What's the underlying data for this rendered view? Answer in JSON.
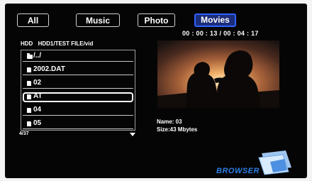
{
  "tabs": [
    {
      "label": "All",
      "active": false
    },
    {
      "label": "Music",
      "active": false
    },
    {
      "label": "Photo",
      "active": false
    },
    {
      "label": "Movies",
      "active": true
    }
  ],
  "playback": {
    "elapsed": "00 : 00 : 13",
    "separator": "/",
    "total": "00 : 04 : 17"
  },
  "path": {
    "device": "HDD",
    "location": "HDD1/TEST FILE/vid"
  },
  "files": [
    {
      "name": "/../",
      "icon": "folder-icon",
      "selected": false
    },
    {
      "name": "2002.DAT",
      "icon": "file-icon",
      "selected": false
    },
    {
      "name": "02",
      "icon": "file-icon",
      "selected": false
    },
    {
      "name": "AT",
      "icon": "file-icon",
      "selected": true
    },
    {
      "name": "04",
      "icon": "file-icon",
      "selected": false
    },
    {
      "name": "05",
      "icon": "file-icon",
      "selected": false
    }
  ],
  "list_counter": "4/37",
  "info": {
    "name": "Name: 03",
    "size": "Size:43 Mbytes"
  },
  "logo_text": "BROWSER",
  "colors": {
    "accent": "#2f62ff",
    "logo": "#2b7fe6",
    "background": "#050505"
  }
}
